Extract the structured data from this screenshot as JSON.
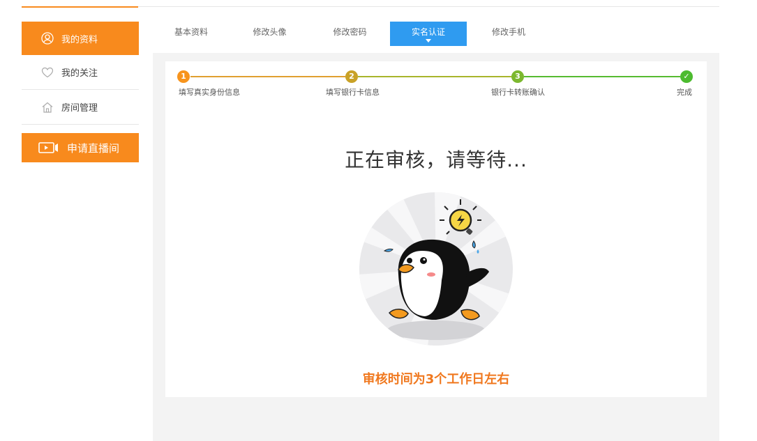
{
  "sidebar": {
    "items": [
      {
        "label": "我的资料",
        "icon": "user-icon",
        "active": true
      },
      {
        "label": "我的关注",
        "icon": "heart-icon",
        "active": false
      },
      {
        "label": "房间管理",
        "icon": "house-icon",
        "active": false
      }
    ],
    "apply_button": {
      "label": "申请直播间",
      "icon": "video-camera-icon"
    }
  },
  "tabs": [
    {
      "label": "基本资料",
      "active": false
    },
    {
      "label": "修改头像",
      "active": false
    },
    {
      "label": "修改密码",
      "active": false
    },
    {
      "label": "实名认证",
      "active": true
    },
    {
      "label": "修改手机",
      "active": false
    }
  ],
  "stepper": {
    "steps": [
      {
        "number": "1",
        "label": "填写真实身份信息",
        "color": "#f7941d"
      },
      {
        "number": "2",
        "label": "填写银行卡信息",
        "color": "#c9a227"
      },
      {
        "number": "3",
        "label": "银行卡转账确认",
        "color": "#7cb82f"
      },
      {
        "number": "✓",
        "label": "完成",
        "color": "#4cbb2f"
      }
    ]
  },
  "review": {
    "title": "正在审核，请等待...",
    "note": "审核时间为3个工作日左右",
    "illustration": "penguin-thinking-illustration"
  },
  "colors": {
    "accent": "#f88a1d",
    "tab_active": "#2f9bf0",
    "note": "#f0781e"
  }
}
